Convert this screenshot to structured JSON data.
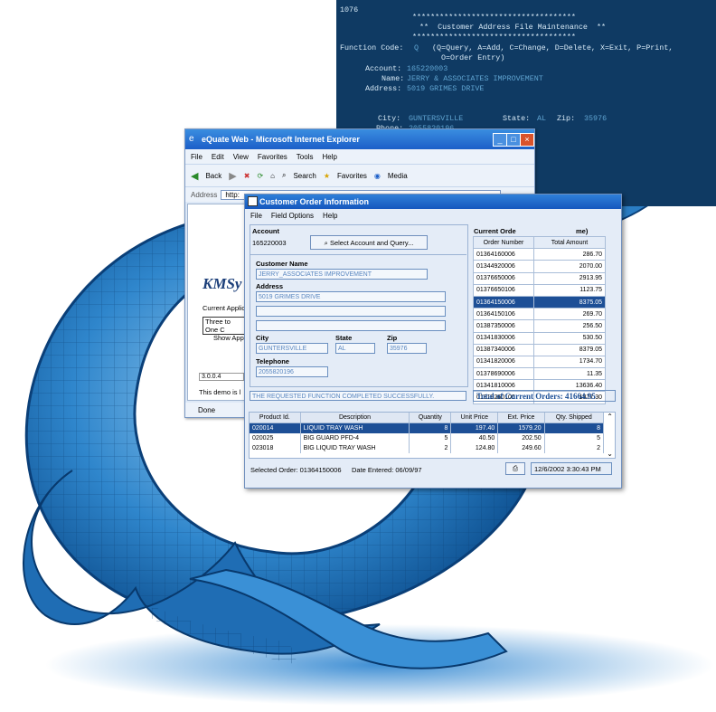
{
  "colors": {
    "terminal_bg": "#0f3a63",
    "logo_blue": "#2a7dc4",
    "title_blue": "#1c5fc8",
    "selection": "#1d4f96"
  },
  "terminal": {
    "code": "1076",
    "stars": "************************************",
    "title": "**  Customer Address File Maintenance  **",
    "function_label": "Function Code:",
    "function_value": "Q",
    "function_help_1": "(Q=Query, A=Add, C=Change, D=Delete, X=Exit, P=Print,",
    "function_help_2": "O=Order Entry)",
    "account_label": "Account:",
    "account_value": "165220003",
    "name_label": "Name:",
    "name_value": "JERRY & ASSOCIATES IMPROVEMENT",
    "address_label": "Address:",
    "address_value": "5019 GRIMES DRIVE",
    "city_label": "City:",
    "city_value": "GUNTERSVILLE",
    "state_label": "State:",
    "state_value": "AL",
    "zip_label": "Zip:",
    "zip_value": "35976",
    "phone_label": "Phone:",
    "phone_value": "2055820196"
  },
  "ie": {
    "title": "eQuate Web - Microsoft Internet Explorer",
    "menu": [
      "File",
      "Edit",
      "View",
      "Favorites",
      "Tools",
      "Help"
    ],
    "toolbar": {
      "back": "Back",
      "search": "Search",
      "favorites": "Favorites",
      "media": "Media"
    },
    "address_label": "Address",
    "address_value": "http:",
    "page_heading": "KMSy",
    "current_app_label": "Current Applica",
    "current_app_value": "Three to One C",
    "show_app": "Show Appli",
    "version": "3.0.0.4",
    "demo_text": "This demo is l",
    "status": "Done"
  },
  "app": {
    "title": "Customer Order Information",
    "menu": [
      "File",
      "Field Options",
      "Help"
    ],
    "account_label": "Account",
    "account_value": "165220003",
    "select_button": "Select Account and Query...",
    "name_label": "Customer Name",
    "name_value": "JERRY_ASSOCIATES IMPROVEMENT",
    "address_label": "Address",
    "address_value": "5019 GRIMES DRIVE",
    "city_label": "City",
    "city_value": "GUNTERSVILLE",
    "state_label": "State",
    "state_value": "AL",
    "zip_label": "Zip",
    "zip_value": "35976",
    "phone_label": "Telephone",
    "phone_value": "2055820196",
    "orders_heading_left": "Current Orde",
    "orders_heading_right": "me)",
    "orders_cols": [
      "Order Number",
      "Total Amount"
    ],
    "orders": [
      [
        "01364160006",
        "286.70"
      ],
      [
        "01344920006",
        "2070.00"
      ],
      [
        "01376650006",
        "2913.95"
      ],
      [
        "01376650106",
        "1123.75"
      ],
      [
        "01364150006",
        "8375.05"
      ],
      [
        "01364150106",
        "269.70"
      ],
      [
        "01387350006",
        "256.50"
      ],
      [
        "01341830006",
        "530.50"
      ],
      [
        "01387340006",
        "8379.05"
      ],
      [
        "01341820006",
        "1734.70"
      ],
      [
        "01378690006",
        "11.35"
      ],
      [
        "01341810006",
        "13636.40"
      ],
      [
        "01319260106",
        "1877.30"
      ]
    ],
    "selected_order_index": 4,
    "message": "THE REQUESTED FUNCTION COMPLETED SUCCESSFULLY.",
    "total": "Total of Current Orders: 41664.95",
    "lines_cols": [
      "Product Id.",
      "Description",
      "Quantity",
      "Unit Price",
      "Ext. Price",
      "Qty. Shipped"
    ],
    "lines": [
      [
        "020014",
        "LIQUID TRAY WASH",
        "8",
        "197.40",
        "1579.20",
        "8"
      ],
      [
        "020025",
        "BIG GUARD PFD-4",
        "5",
        "40.50",
        "202.50",
        "5"
      ],
      [
        "023018",
        "BIG LIQUID TRAY WASH",
        "2",
        "124.80",
        "249.60",
        "2"
      ]
    ],
    "selected_line_index": 0,
    "status_order": "Selected Order: 01364150006",
    "status_date": "Date Entered: 06/09/97",
    "status_time": "12/6/2002 3:30:43 PM"
  }
}
